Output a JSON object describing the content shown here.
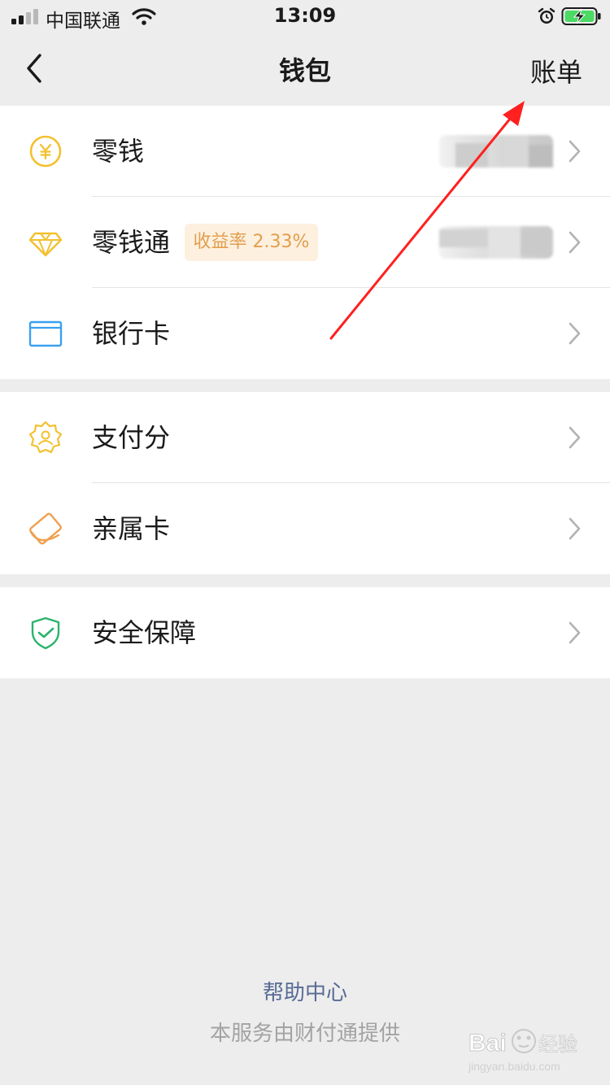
{
  "status_bar": {
    "carrier": "中国联通",
    "time": "13:09",
    "icons": [
      "signal-icon",
      "wifi-icon",
      "alarm-icon",
      "battery-charging-icon"
    ]
  },
  "nav": {
    "title": "钱包",
    "right_action": "账单",
    "back_icon": "chevron-left-icon"
  },
  "groups": [
    {
      "items": [
        {
          "label": "零钱",
          "icon": "yuan-coin-icon",
          "value_blurred": true
        },
        {
          "label": "零钱通",
          "icon": "diamond-icon",
          "badge": "收益率 2.33%",
          "value_blurred": true
        },
        {
          "label": "银行卡",
          "icon": "bank-card-icon"
        }
      ]
    },
    {
      "items": [
        {
          "label": "支付分",
          "icon": "pay-score-icon"
        },
        {
          "label": "亲属卡",
          "icon": "family-card-icon"
        }
      ]
    },
    {
      "items": [
        {
          "label": "安全保障",
          "icon": "shield-check-icon"
        }
      ]
    }
  ],
  "footer": {
    "help": "帮助中心",
    "provider": "本服务由财付通提供"
  },
  "watermark": {
    "brand": "Baidu经验",
    "url": "jingyan.baidu.com"
  },
  "colors": {
    "background": "#ededed",
    "link": "#576b95",
    "badge_text": "#e29e4c",
    "badge_bg": "#fdf0df",
    "annotation_arrow": "#ff2020",
    "yuan_icon": "#f2c12e",
    "bank_card_icon": "#3aa0f0",
    "shield_icon": "#2bb36b",
    "family_card_icon": "#f0a050"
  }
}
